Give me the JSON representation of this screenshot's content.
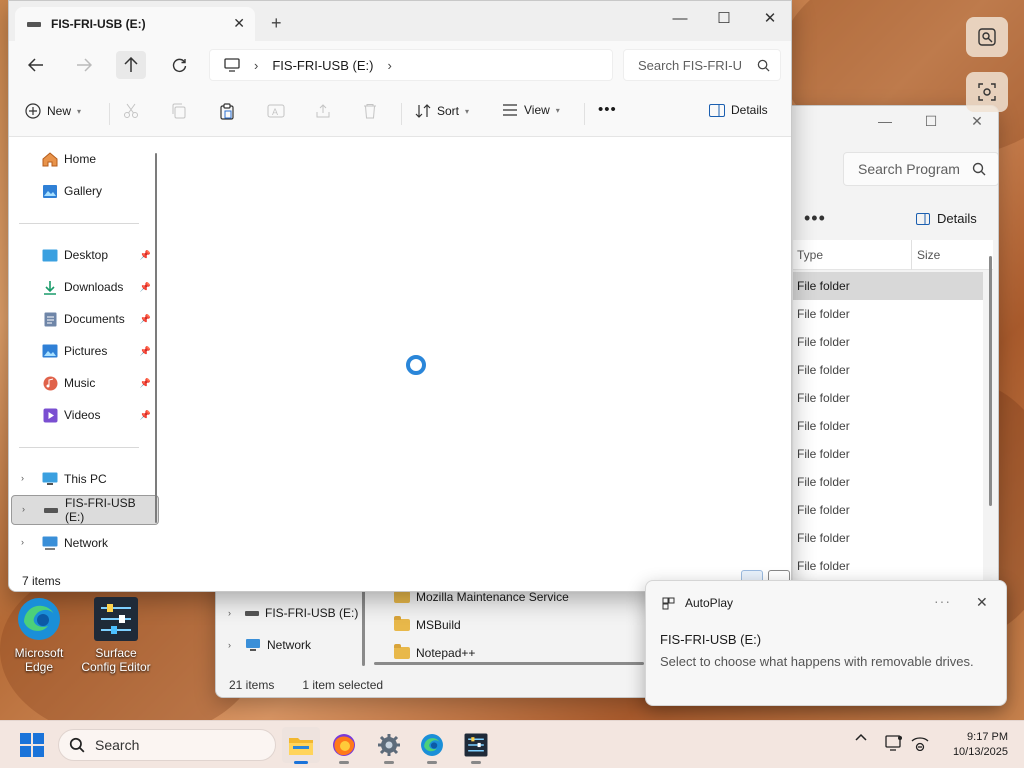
{
  "main_window": {
    "tab_title": "FIS-FRI-USB (E:)",
    "new_tab": "+",
    "breadcrumb": {
      "location": "FIS-FRI-USB (E:)"
    },
    "search_placeholder": "Search FIS-FRI-U",
    "toolbar": {
      "new": "New",
      "sort": "Sort",
      "view": "View",
      "more": "•••",
      "details": "Details"
    },
    "sidebar": {
      "quick": [
        {
          "label": "Home",
          "icon": "home-icon"
        },
        {
          "label": "Gallery",
          "icon": "gallery-icon"
        }
      ],
      "pinned": [
        {
          "label": "Desktop",
          "icon": "desktop-icon",
          "color": "#3aa0e0"
        },
        {
          "label": "Downloads",
          "icon": "download-icon",
          "color": "#1b9c6b"
        },
        {
          "label": "Documents",
          "icon": "documents-icon",
          "color": "#6f86a8"
        },
        {
          "label": "Pictures",
          "icon": "pictures-icon",
          "color": "#2f80d6"
        },
        {
          "label": "Music",
          "icon": "music-icon",
          "color": "#e0624a"
        },
        {
          "label": "Videos",
          "icon": "videos-icon",
          "color": "#7a4fd1"
        }
      ],
      "devices": [
        {
          "label": "This PC",
          "icon": "computer-icon"
        },
        {
          "label": "FIS-FRI-USB (E:)",
          "icon": "drive-icon",
          "selected": true
        },
        {
          "label": "Network",
          "icon": "network-icon"
        }
      ]
    },
    "status": "7 items"
  },
  "background_window": {
    "search_placeholder": "Search Program",
    "toolbar_more": "•••",
    "details": "Details",
    "columns": {
      "type": "Type",
      "size": "Size"
    },
    "rows": [
      "File folder",
      "File folder",
      "File folder",
      "File folder",
      "File folder",
      "File folder",
      "File folder",
      "File folder",
      "File folder",
      "File folder",
      "File folder"
    ],
    "nav": {
      "drive": "FIS-FRI-USB (E:)",
      "network": "Network"
    },
    "files": [
      "Mozilla Maintenance Service",
      "MSBuild",
      "Notepad++"
    ],
    "status_items": "21 items",
    "status_selected": "1 item selected"
  },
  "desktop_icons": [
    {
      "label": "Microsoft Edge"
    },
    {
      "label": "Surface Config Editor"
    }
  ],
  "toast": {
    "app": "AutoPlay",
    "more": "···",
    "title": "FIS-FRI-USB (E:)",
    "message": "Select to choose what happens with removable drives."
  },
  "taskbar": {
    "search_placeholder": "Search",
    "time": "9:17 PM",
    "date": "10/13/2025"
  }
}
